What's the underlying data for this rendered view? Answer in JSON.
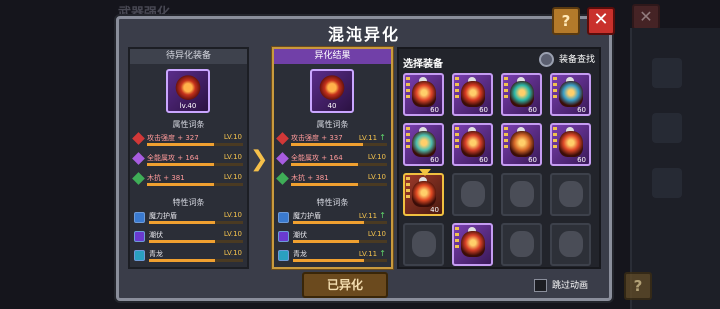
{
  "window": {
    "title": "混沌异化",
    "background_title": "武器强化",
    "close_symbol": "✕",
    "help_symbol": "?"
  },
  "left_panel": {
    "header": "待异化装备",
    "equip_level": "lv.40",
    "attr_section_title": "属性词条",
    "stats": [
      {
        "name": "攻击强度 + 327",
        "level": "LV.10",
        "fill": 0.7,
        "color": "red"
      },
      {
        "name": "全能属攻 + 164",
        "level": "LV.10",
        "fill": 0.7,
        "color": "pur"
      },
      {
        "name": "木抗 + 381",
        "level": "LV.10",
        "fill": 0.7,
        "color": "grn"
      }
    ],
    "trait_section_title": "特性词条",
    "traits": [
      {
        "name": "魔力护盾",
        "level": "LV.10",
        "fill": 0.7
      },
      {
        "name": "潮伏",
        "level": "LV.10",
        "fill": 0.7
      },
      {
        "name": "青龙",
        "level": "LV.10",
        "fill": 0.7
      }
    ]
  },
  "right_panel": {
    "header": "异化结果",
    "equip_level": "40",
    "attr_section_title": "属性词条",
    "stats": [
      {
        "name": "攻击强度 + 337",
        "level": "LV.11",
        "fill": 0.75,
        "color": "red",
        "up": true
      },
      {
        "name": "全能属攻 + 164",
        "level": "LV.10",
        "fill": 0.7,
        "color": "pur",
        "up": false
      },
      {
        "name": "木抗 + 381",
        "level": "LV.10",
        "fill": 0.7,
        "color": "grn",
        "up": false
      }
    ],
    "trait_section_title": "特性词条",
    "traits": [
      {
        "name": "魔力护盾",
        "level": "LV.11",
        "fill": 0.75,
        "up": true
      },
      {
        "name": "潮伏",
        "level": "LV.10",
        "fill": 0.7,
        "up": false
      },
      {
        "name": "青龙",
        "level": "LV.11",
        "fill": 0.75,
        "up": true
      }
    ],
    "up_arrow": "↑"
  },
  "arrow_symbol": "❯",
  "grid": {
    "header": "选择装备",
    "search_label": "装备查找",
    "slots": [
      {
        "state": "filled",
        "level": "60",
        "color": "#e2462a"
      },
      {
        "state": "filled",
        "level": "60",
        "color": "#d83a22"
      },
      {
        "state": "filled",
        "level": "60",
        "color": "#2bb8a8"
      },
      {
        "state": "filled",
        "level": "60",
        "color": "#3aa0c8"
      },
      {
        "state": "filled",
        "level": "60",
        "color": "#4ec0b0"
      },
      {
        "state": "filled",
        "level": "60",
        "color": "#d8402a"
      },
      {
        "state": "filled",
        "level": "60",
        "color": "#d86a2a"
      },
      {
        "state": "filled",
        "level": "60",
        "color": "#e04a28"
      },
      {
        "state": "selected",
        "level": "40",
        "color": "#e24a24"
      },
      {
        "state": "empty",
        "level": "",
        "color": ""
      },
      {
        "state": "empty",
        "level": "",
        "color": ""
      },
      {
        "state": "empty",
        "level": "",
        "color": ""
      },
      {
        "state": "empty",
        "level": "",
        "color": ""
      },
      {
        "state": "filled",
        "level": "",
        "color": "#d84028"
      },
      {
        "state": "empty",
        "level": "",
        "color": ""
      },
      {
        "state": "empty",
        "level": "",
        "color": ""
      }
    ]
  },
  "main_button": "已异化",
  "skip_label": "跳过动画"
}
